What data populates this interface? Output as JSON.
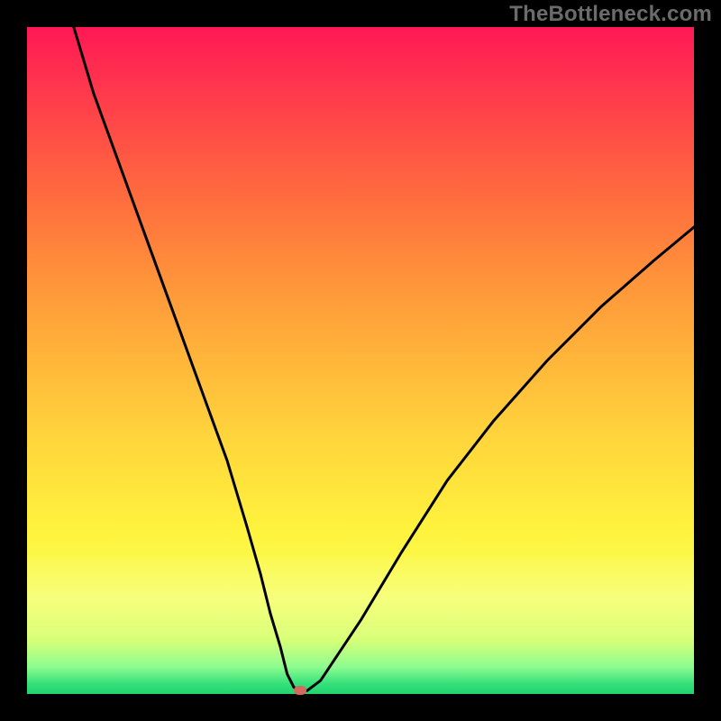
{
  "watermark": "TheBottleneck.com",
  "colors": {
    "frame": "#000000",
    "watermark_text": "#6b6b6b",
    "curve": "#000000",
    "marker": "#d46a5e",
    "gradient": {
      "top": "#ff1855",
      "mid": "#ffd63c",
      "bottom": "#23d36e"
    }
  },
  "chart_data": {
    "type": "line",
    "title": "",
    "xlabel": "",
    "ylabel": "",
    "xlim": [
      0,
      100
    ],
    "ylim": [
      0,
      100
    ],
    "grid": false,
    "series": [
      {
        "name": "bottleneck-curve",
        "x": [
          7,
          10,
          14,
          18,
          22,
          26,
          30,
          33,
          35,
          36.5,
          38,
          39,
          40,
          41,
          42,
          44,
          50,
          56,
          63,
          70,
          78,
          86,
          94,
          100
        ],
        "y": [
          100,
          90,
          79,
          68,
          57,
          46,
          35,
          25,
          18,
          12,
          7,
          3,
          1,
          0.5,
          0.5,
          2,
          11,
          21,
          32,
          41,
          50,
          58,
          65,
          70
        ]
      }
    ],
    "annotations": [
      {
        "name": "optimal-marker",
        "x": 41,
        "y": 0.5
      }
    ],
    "background": {
      "type": "vertical-gradient",
      "meaning": "red=high-bottleneck, green=low-bottleneck"
    }
  }
}
